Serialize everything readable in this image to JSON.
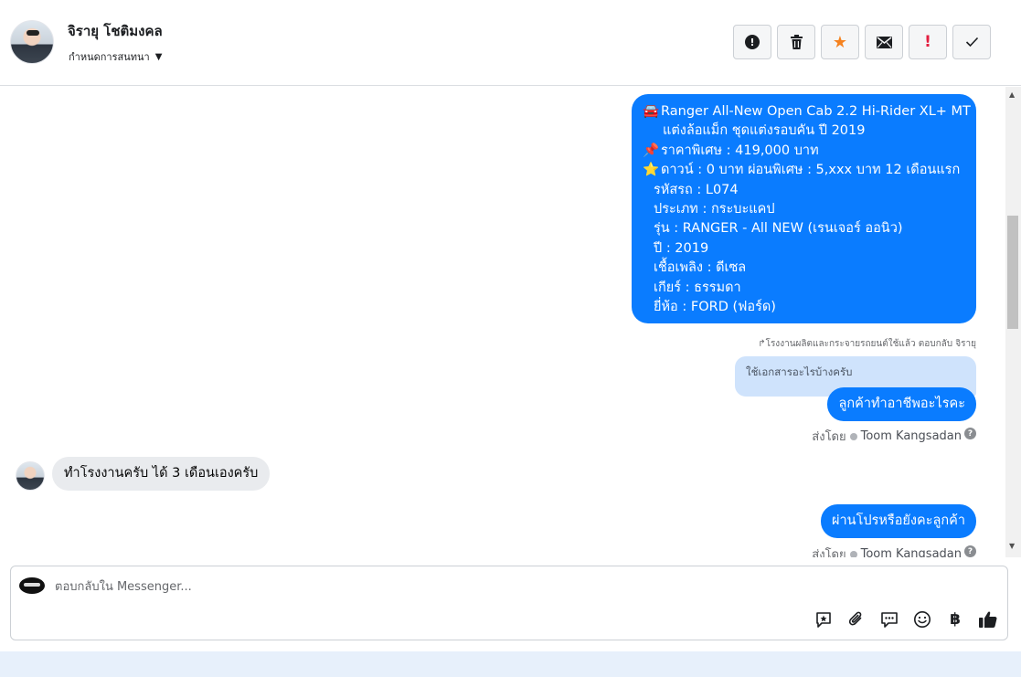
{
  "header": {
    "contact_name": "จิรายุ โชติมงคล",
    "assign_label": "กำหนดการสนทนา"
  },
  "toolbar": {
    "alert_label": "!",
    "important_label": "!"
  },
  "messages": {
    "car_listing": {
      "line1": "Ranger All-New Open Cab 2.2 Hi-Rider XL+ MT",
      "line2": "แต่งล้อแม็ก ชุดแต่งรอบคัน ปี 2019",
      "line3": "ราคาพิเศษ : 419,000 บาท",
      "line4": "ดาวน์ : 0 บาท ผ่อนพิเศษ : 5,xxx บาท 12 เดือนแรก",
      "line5": "รหัสรถ : L074",
      "line6": "ประเภท : กระบะแคป",
      "line7": "รุ่น : RANGER - All NEW (เรนเจอร์ ออนิว)",
      "line8": "ปี : 2019",
      "line9": "เชื้อเพลิง : ดีเซล",
      "line10": "เกียร์ : ธรรมดา",
      "line11": "ยี่ห้อ : FORD (ฟอร์ด)"
    },
    "reply_note": "↱โรงงานผลิตและกระจายรถยนต์ใช้แล้ว ตอบกลับ จิรายุ",
    "quoted_text": "ใช้เอกสารอะไรบ้างครับ",
    "outgoing_1": "ลูกค้าทำอาชีพอะไรคะ",
    "sent_by_label": "ส่งโดย",
    "sent_by_name": "Toom Kangsadan",
    "incoming_1": "ทำโรงงานครับ ได้ 3 เดือนเองครับ",
    "outgoing_2": "ผ่านโปรหรือยังคะลูกค้า",
    "sent_by_label_2": "ส่งโดย",
    "sent_by_name_2": "Toom Kangsadan"
  },
  "composer": {
    "placeholder": "ตอบกลับใน Messenger...",
    "currency_symbol": "฿"
  },
  "colors": {
    "accent": "#0a7cff",
    "quote_bg": "#cfe3fc",
    "incoming_bg": "#e9ebee",
    "star": "#f5821f",
    "important": "#e41e3f"
  }
}
